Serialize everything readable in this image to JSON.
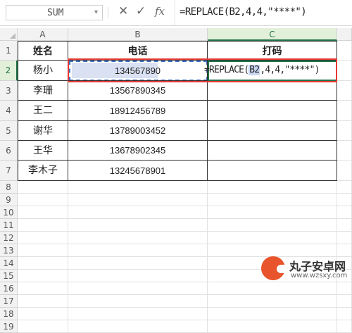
{
  "formula_bar": {
    "name_box": "SUM",
    "cancel_icon": "✕",
    "confirm_icon": "✓",
    "fx_label": "fx",
    "formula": "=REPLACE(B2,4,4,\"****\")"
  },
  "columns": [
    "A",
    "B",
    "C"
  ],
  "rows": [
    "1",
    "2",
    "3",
    "4",
    "5",
    "6",
    "7",
    "8",
    "9",
    "10",
    "11",
    "12",
    "13",
    "14",
    "15",
    "16",
    "17",
    "18",
    "19"
  ],
  "table": {
    "headers": {
      "name": "姓名",
      "phone": "电话",
      "mask": "打码"
    },
    "data": [
      {
        "name": "杨小",
        "phone": "134567890"
      },
      {
        "name": "李珊",
        "phone": "13567890345"
      },
      {
        "name": "王二",
        "phone": "18912456789"
      },
      {
        "name": "谢华",
        "phone": "13789003452"
      },
      {
        "name": "王华",
        "phone": "13678902345"
      },
      {
        "name": "李木子",
        "phone": "13245678901"
      }
    ]
  },
  "active_cell": {
    "prefix": "=REPLACE(",
    "ref": "B2",
    "suffix": ",4,4,\"****\")"
  },
  "watermark": {
    "title": "丸子安卓网",
    "url": "www.wzsxy.com"
  },
  "colors": {
    "highlight": "#e53935",
    "active": "#217346",
    "reference": "#4472c4"
  }
}
